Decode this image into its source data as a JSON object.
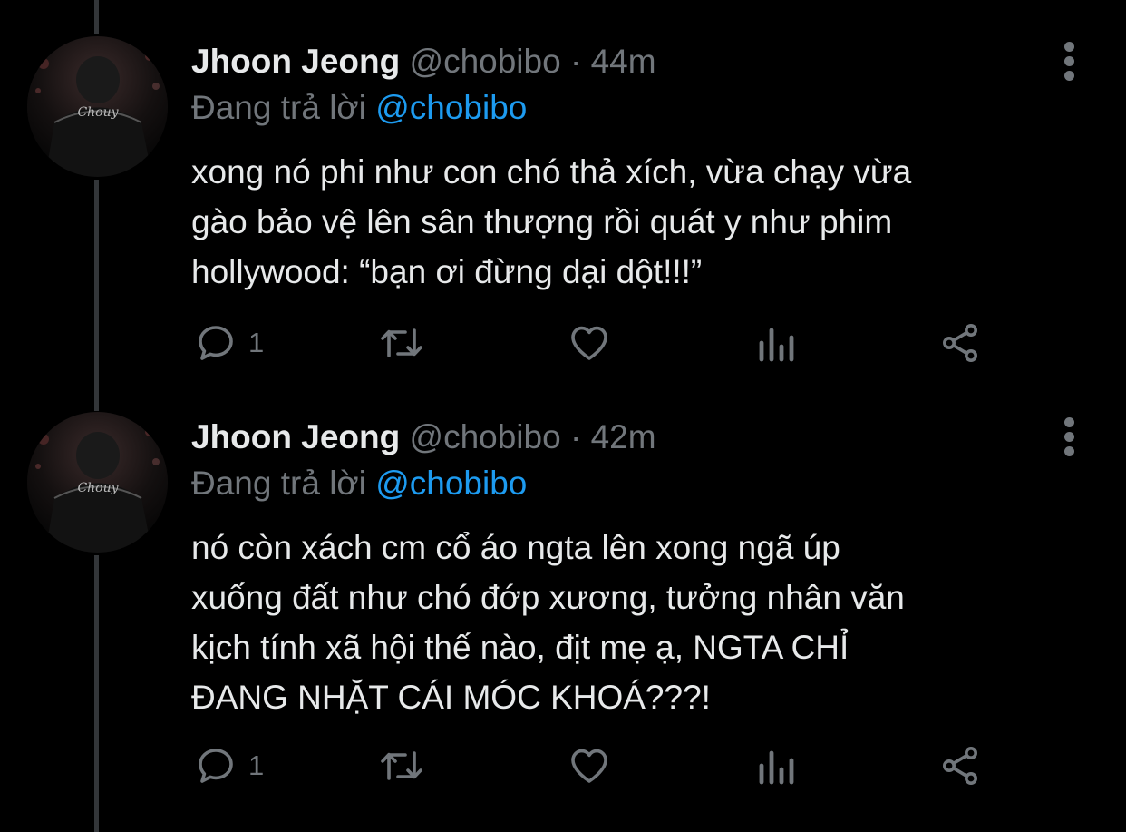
{
  "colors": {
    "background": "#000000",
    "text_primary": "#e7e9ea",
    "text_secondary": "#71767b",
    "accent": "#1d9bf0",
    "thread_line": "#333639"
  },
  "tweets": [
    {
      "author_name": "Jhoon Jeong",
      "author_handle": "@chobibo",
      "dot": "·",
      "time": "44m",
      "replying_prefix": "Đang trả lời",
      "replying_handle": "@chobibo",
      "text": "xong nó phi như con chó thả xích, vừa chạy vừa\ngào bảo vệ lên sân thượng rồi quát y như phim\nhollywood: “bạn ơi đừng dại dột!!!”",
      "reply_count": "1",
      "icons": [
        "reply-icon",
        "retweet-icon",
        "like-icon",
        "analytics-icon",
        "share-icon",
        "more-icon"
      ],
      "avatar_text": "Chouy"
    },
    {
      "author_name": "Jhoon Jeong",
      "author_handle": "@chobibo",
      "dot": "·",
      "time": "42m",
      "replying_prefix": "Đang trả lời",
      "replying_handle": "@chobibo",
      "text": "nó còn xách cm cổ áo ngta lên xong ngã úp\nxuống đất như chó đớp xương, tưởng nhân văn\nkịch tính xã hội thế nào, địt mẹ ạ, NGTA CHỈ\nĐANG NHẶT CÁI MÓC KHOÁ???!",
      "reply_count": "1",
      "icons": [
        "reply-icon",
        "retweet-icon",
        "like-icon",
        "analytics-icon",
        "share-icon",
        "more-icon"
      ],
      "avatar_text": "Chouy"
    }
  ]
}
